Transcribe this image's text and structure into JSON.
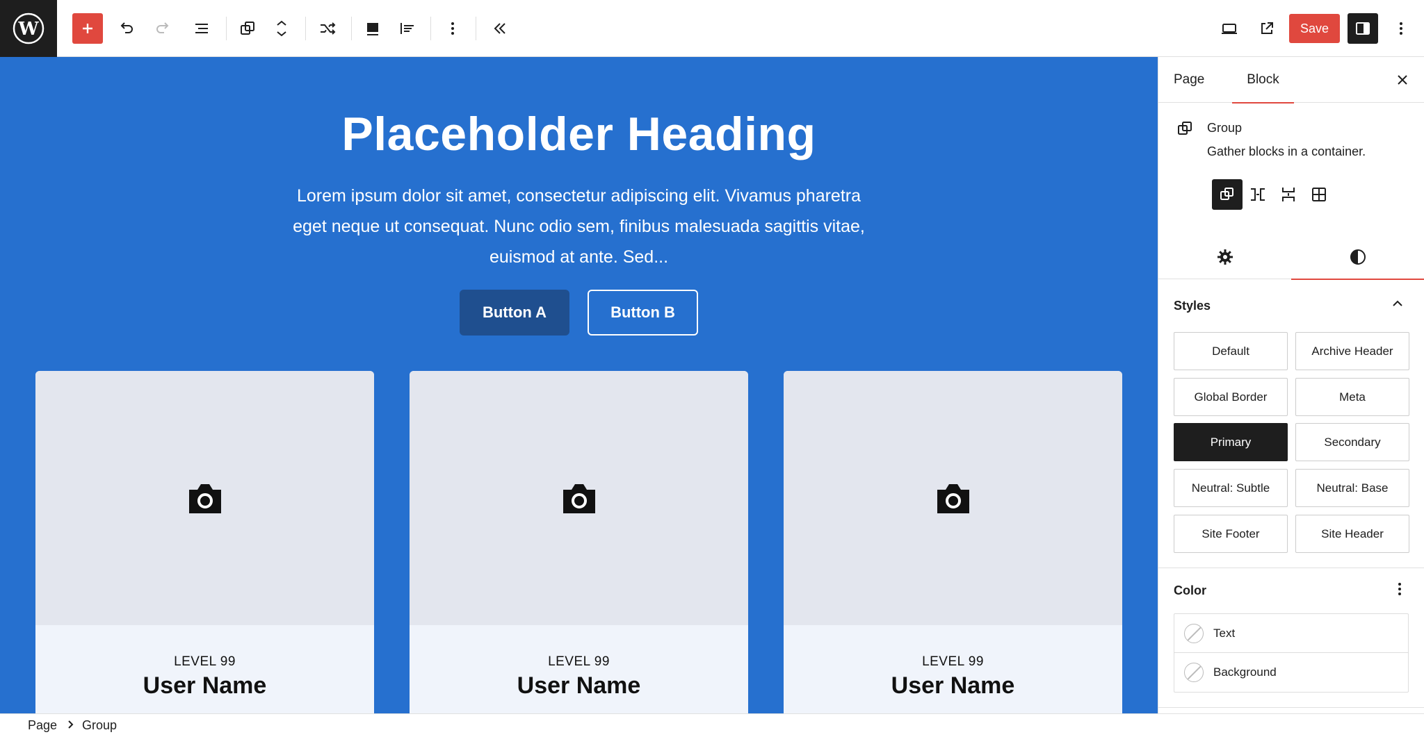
{
  "toolbar": {
    "save_label": "Save",
    "colors": {
      "accent": "#e0483e",
      "dark": "#1e1e1e"
    }
  },
  "canvas": {
    "background": "#2670cf",
    "heading": "Placeholder Heading",
    "paragraph": "Lorem ipsum dolor sit amet, consectetur adipiscing elit. Vivamus pharetra eget neque ut consequat. Nunc odio sem, finibus malesuada sagittis vitae, euismod at ante. Sed...",
    "button_a": "Button A",
    "button_b": "Button B",
    "cards": [
      {
        "level": "LEVEL 99",
        "name": "User Name"
      },
      {
        "level": "LEVEL 99",
        "name": "User Name"
      },
      {
        "level": "LEVEL 99",
        "name": "User Name"
      }
    ]
  },
  "sidebar": {
    "tabs": [
      "Page",
      "Block"
    ],
    "block": {
      "title": "Group",
      "description": "Gather blocks in a container."
    },
    "styles": {
      "title": "Styles",
      "options": [
        "Default",
        "Archive Header",
        "Global Border",
        "Meta",
        "Primary",
        "Secondary",
        "Neutral: Subtle",
        "Neutral: Base",
        "Site Footer",
        "Site Header"
      ],
      "selected": "Primary"
    },
    "color": {
      "title": "Color",
      "items": [
        "Text",
        "Background"
      ]
    }
  },
  "breadcrumb": [
    "Page",
    "Group"
  ]
}
